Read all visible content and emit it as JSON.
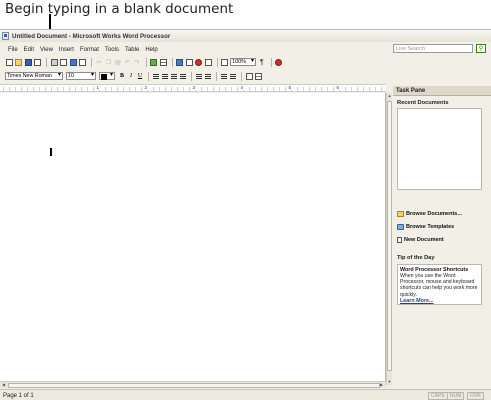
{
  "callout": {
    "text": "Begin typing in a blank document"
  },
  "window": {
    "title": "Untitled Document - Microsoft Works Word Processor"
  },
  "menu": {
    "items": [
      "File",
      "Edit",
      "View",
      "Insert",
      "Format",
      "Tools",
      "Table",
      "Help"
    ]
  },
  "search": {
    "placeholder": "Live Search"
  },
  "toolbar": {
    "zoom": "100%",
    "font_name": "Times New Roman",
    "font_size": "10",
    "bold": "B",
    "italic": "I",
    "underline": "U",
    "pilcrow": "¶"
  },
  "ruler": {
    "numbers": [
      "1",
      "2",
      "3",
      "4",
      "5",
      "6"
    ]
  },
  "status": {
    "page": "Page 1 of 1",
    "caps": "CAPS",
    "num": "NUM",
    "ovr": "OVR"
  },
  "task_pane": {
    "title": "Task Pane",
    "recent_label": "Recent Documents",
    "browse_documents": "Browse Documents...",
    "browse_templates": "Browse Templates",
    "new_document": "New Document",
    "tip_label": "Tip of the Day",
    "tip_title": "Word Processor Shortcuts",
    "tip_body": "When you use the Word Processor, mouse and keyboard shortcuts can help you work more quickly.",
    "tip_link": "Learn More..."
  },
  "colors": {
    "window_bg": "#f1efe6",
    "link": "#1a3fb5"
  }
}
